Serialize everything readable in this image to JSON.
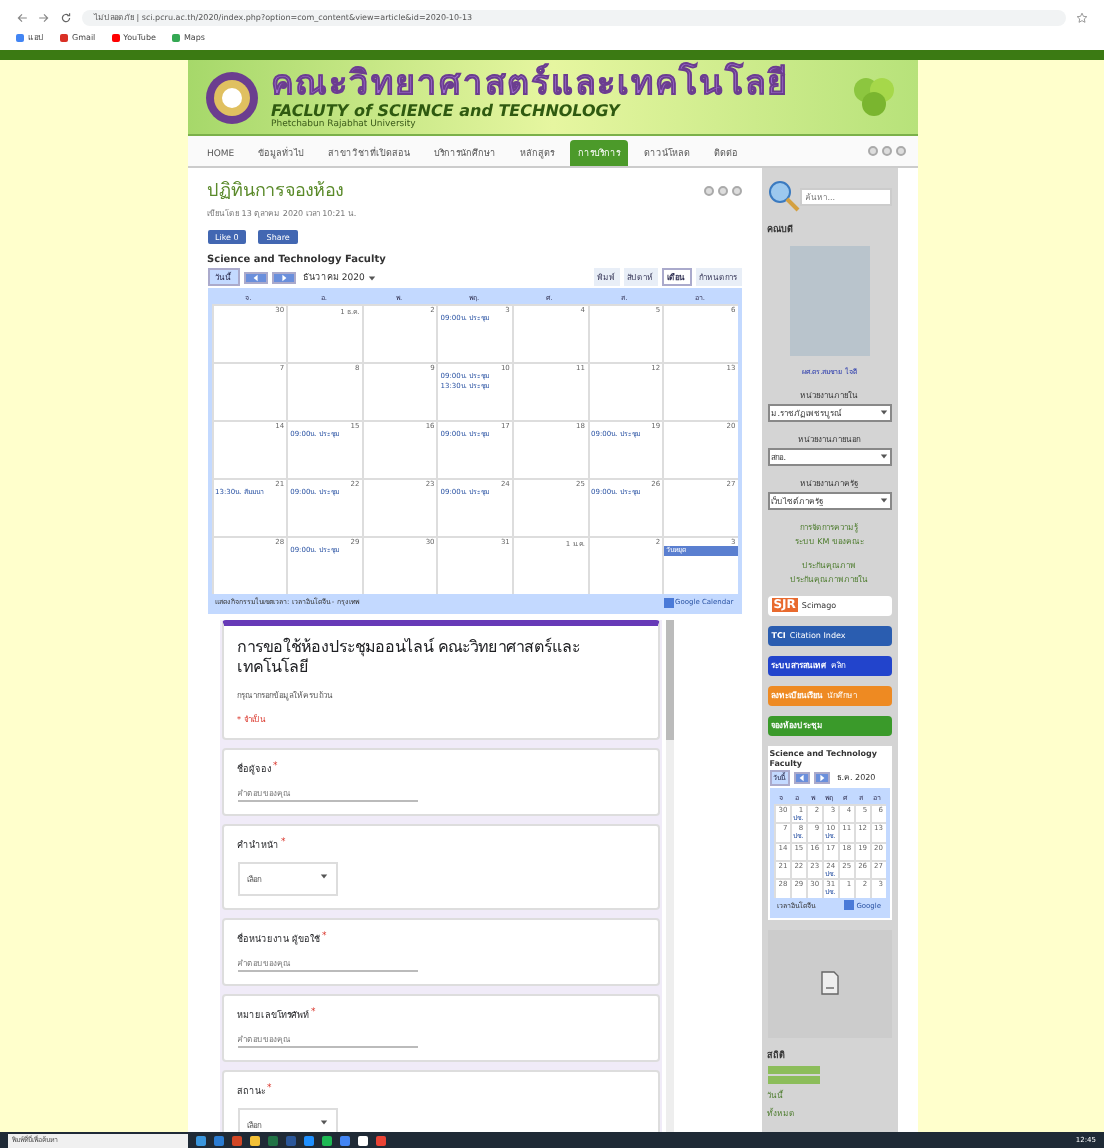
{
  "browser": {
    "url": "ไม่ปลอดภัย | sci.pcru.ac.th/2020/index.php?option=com_content&view=article&id=2020-10-13",
    "bookmarks": [
      "แอป",
      "Gmail",
      "YouTube",
      "Maps"
    ]
  },
  "header": {
    "thai_title": "คณะวิทยาศาสตร์และเทคโนโลยี",
    "english_title": "FACLUTY of SCIENCE and TECHNOLOGY",
    "university": "Phetchabun Rajabhat University"
  },
  "nav": [
    {
      "label": "HOME",
      "selected": false
    },
    {
      "label": "ข้อมูลทั่วไป",
      "selected": false
    },
    {
      "label": "สาขาวิชาที่เปิดสอน",
      "selected": false
    },
    {
      "label": "บริการนักศึกษา",
      "selected": false
    },
    {
      "label": "หลักสูตร",
      "selected": false
    },
    {
      "label": "การบริการ",
      "selected": true
    },
    {
      "label": "ดาวน์โหลด",
      "selected": false
    },
    {
      "label": "ติดต่อ",
      "selected": false
    }
  ],
  "article": {
    "title": "ปฏิทินการจองห้อง",
    "meta": "เขียนโดย 13 ตุลาคม 2020 เวลา 10:21 น.",
    "like": "Like 0",
    "share": "Share"
  },
  "calendar": {
    "title": "Science and Technology Faculty",
    "today": "วันนี้",
    "month": "ธันวาคม 2020",
    "views": [
      {
        "label": "พิมพ์",
        "selected": false
      },
      {
        "label": "สัปดาห์",
        "selected": false
      },
      {
        "label": "เดือน",
        "selected": true
      },
      {
        "label": "กำหนดการ",
        "selected": false
      }
    ],
    "weekdays": [
      "จ.",
      "อ.",
      "พ.",
      "พฤ.",
      "ศ.",
      "ส.",
      "อา."
    ],
    "weeks": [
      [
        {
          "date": "30"
        },
        {
          "date": "1 ธ.ค."
        },
        {
          "date": "2"
        },
        {
          "date": "3",
          "events": [
            "09:00น. ประชุม"
          ]
        },
        {
          "date": "4"
        },
        {
          "date": "5"
        },
        {
          "date": "6"
        }
      ],
      [
        {
          "date": "7"
        },
        {
          "date": "8"
        },
        {
          "date": "9"
        },
        {
          "date": "10",
          "events": [
            "09:00น. ประชุม",
            "13:30น. ประชุม"
          ]
        },
        {
          "date": "11"
        },
        {
          "date": "12"
        },
        {
          "date": "13"
        }
      ],
      [
        {
          "date": "14"
        },
        {
          "date": "15",
          "events": [
            "09:00น. ประชุม"
          ]
        },
        {
          "date": "16"
        },
        {
          "date": "17",
          "events": [
            "09:00น. ประชุม"
          ]
        },
        {
          "date": "18"
        },
        {
          "date": "19",
          "events": [
            "09:00น. ประชุม"
          ]
        },
        {
          "date": "20"
        }
      ],
      [
        {
          "date": "21",
          "events": [
            "13:30น. สัมมนา"
          ]
        },
        {
          "date": "22",
          "events": [
            "09:00น. ประชุม"
          ]
        },
        {
          "date": "23"
        },
        {
          "date": "24",
          "events": [
            "09:00น. ประชุม"
          ]
        },
        {
          "date": "25"
        },
        {
          "date": "26",
          "events": [
            "09:00น. ประชุม"
          ]
        },
        {
          "date": "27"
        }
      ],
      [
        {
          "date": "28"
        },
        {
          "date": "29",
          "events": [
            "09:00น. ประชุม"
          ]
        },
        {
          "date": "30"
        },
        {
          "date": "31"
        },
        {
          "date": "1 ม.ค."
        },
        {
          "date": "2"
        },
        {
          "date": "3",
          "events": [
            "วันหยุด"
          ]
        }
      ]
    ],
    "footer": "แสดงกิจกรรมในเขตเวลา: เวลาอินโดจีน - กรุงเทพ",
    "google": "Google Calendar"
  },
  "form": {
    "title": "การขอใช้ห้องประชุมออนไลน์ คณะวิทยาศาสตร์และเทคโนโลยี",
    "description": "กรุณากรอกข้อมูลให้ครบถ้วน",
    "required_note": "* จำเป็น",
    "questions": [
      {
        "kind": "text",
        "label": "ชื่อผู้จอง",
        "mark": "*",
        "placeholder": "คำตอบของคุณ"
      },
      {
        "kind": "select",
        "label": "คำนำหน้า",
        "mark": "*",
        "value": "เลือก"
      },
      {
        "kind": "text",
        "label": "ชื่อหน่วยงาน ผู้ขอใช้",
        "mark": "*",
        "placeholder": "คำตอบของคุณ"
      },
      {
        "kind": "text",
        "label": "หมายเลขโทรศัพท์",
        "mark": "*",
        "placeholder": "คำตอบของคุณ"
      },
      {
        "kind": "select",
        "label": "สถานะ",
        "mark": "*",
        "value": "เลือก"
      }
    ]
  },
  "sidebar": {
    "search_placeholder": "ค้นหา...",
    "dean_heading": "คณบดี",
    "dean_caption": "ผศ.ดร.สมชาย ใจดี",
    "selects": [
      {
        "label": "หน่วยงานภายใน",
        "value": "ม.ราชภัฏเพชรบูรณ์"
      },
      {
        "label": "หน่วยงานภายนอก",
        "value": "สกอ."
      },
      {
        "label": "หน่วยงานภาครัฐ",
        "value": "เว็บไซต์ภาครัฐ"
      }
    ],
    "links": [
      {
        "title": "การจัดการความรู้",
        "text": "ระบบ KM ของคณะ"
      },
      {
        "title": "ประกันคุณภาพ",
        "text": "ประกันคุณภาพภายใน"
      }
    ],
    "banners": [
      {
        "kind": "sjr",
        "label": "SJR",
        "text": "Scimago"
      },
      {
        "kind": "tci",
        "label": "TCI",
        "text": "Citation Index"
      },
      {
        "kind": "blue",
        "label": "ระบบสารสนเทศ",
        "text": "คลิก"
      },
      {
        "kind": "orange",
        "label": "ลงทะเบียนเรียน",
        "text": "นักศึกษา"
      },
      {
        "kind": "green",
        "label": "จองห้องประชุม"
      }
    ],
    "mini_calendar": {
      "title": "Science and Technology Faculty",
      "today": "วันนี้",
      "month": "ธ.ค. 2020",
      "weekdays": [
        "จ",
        "อ",
        "พ",
        "พฤ",
        "ศ",
        "ส",
        "อา"
      ],
      "weeks": [
        [
          {
            "date": "30"
          },
          {
            "date": "1",
            "event": "ปช."
          },
          {
            "date": "2"
          },
          {
            "date": "3"
          },
          {
            "date": "4"
          },
          {
            "date": "5"
          },
          {
            "date": "6"
          }
        ],
        [
          {
            "date": "7"
          },
          {
            "date": "8",
            "event": "ปช."
          },
          {
            "date": "9"
          },
          {
            "date": "10",
            "event": "ปช."
          },
          {
            "date": "11"
          },
          {
            "date": "12"
          },
          {
            "date": "13"
          }
        ],
        [
          {
            "date": "14"
          },
          {
            "date": "15"
          },
          {
            "date": "16"
          },
          {
            "date": "17"
          },
          {
            "date": "18"
          },
          {
            "date": "19"
          },
          {
            "date": "20"
          }
        ],
        [
          {
            "date": "21"
          },
          {
            "date": "22"
          },
          {
            "date": "23"
          },
          {
            "date": "24",
            "event": "ปช."
          },
          {
            "date": "25"
          },
          {
            "date": "26"
          },
          {
            "date": "27"
          }
        ],
        [
          {
            "date": "28"
          },
          {
            "date": "29"
          },
          {
            "date": "30"
          },
          {
            "date": "31",
            "event": "ปช."
          },
          {
            "date": "1"
          },
          {
            "date": "2"
          },
          {
            "date": "3"
          }
        ]
      ],
      "footer": "เวลาอินโดจีน",
      "google": "Google"
    },
    "stats_heading": "สถิติ",
    "stats_text": [
      "วันนี้",
      "ทั้งหมด"
    ]
  },
  "taskbar": {
    "search": "พิมพ์ที่นี่เพื่อค้นหา",
    "time": "12:45"
  }
}
